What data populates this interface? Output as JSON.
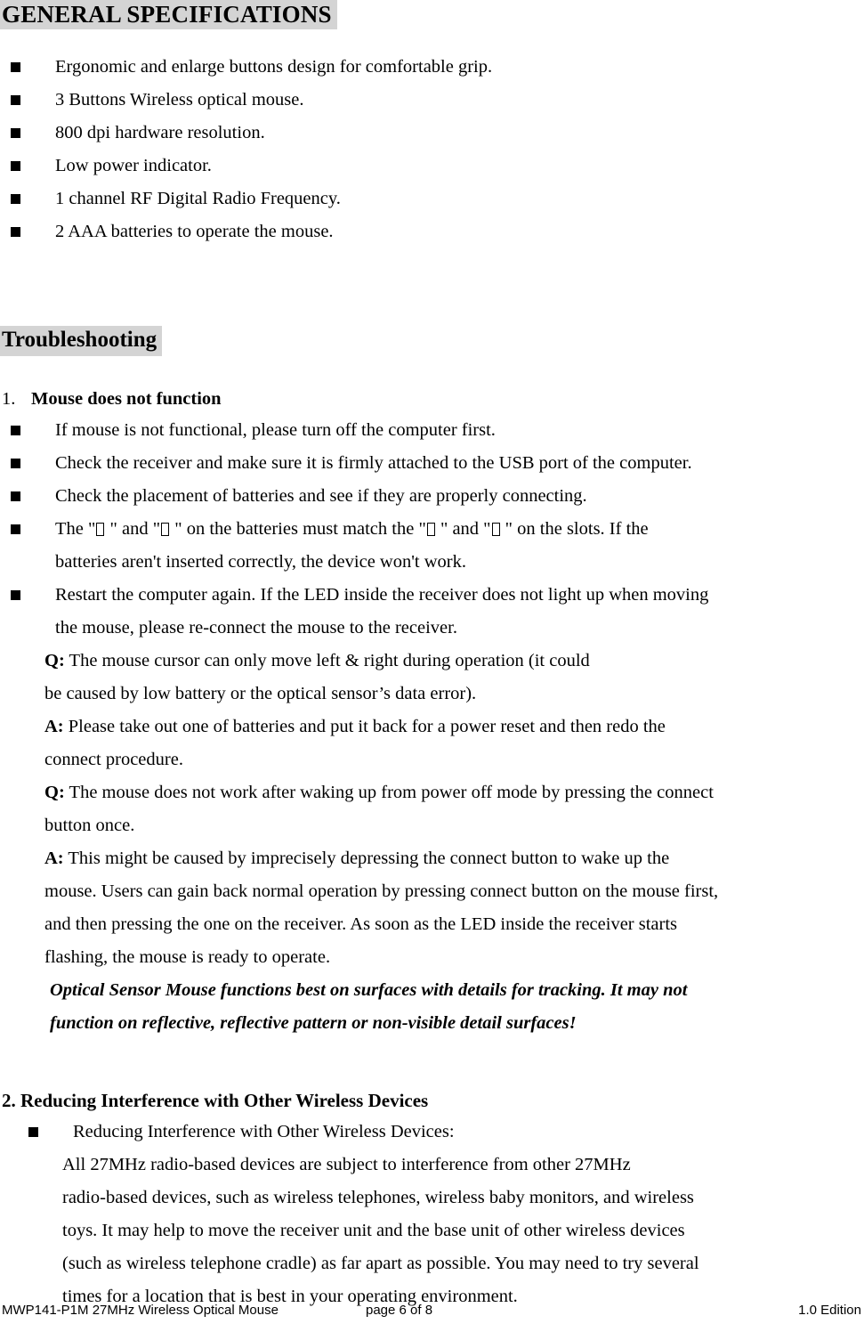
{
  "document": {
    "section_general": {
      "heading": "GENERAL SPECIFICATIONS",
      "bullets": [
        "Ergonomic and enlarge buttons design for comfortable grip.",
        "3 Buttons Wireless optical mouse.",
        "800 dpi hardware resolution.",
        "Low power indicator.",
        "1 channel RF Digital Radio Frequency.",
        "2 AAA batteries to operate the mouse."
      ]
    },
    "section_troubleshooting": {
      "heading": "Troubleshooting",
      "item1": {
        "number": "1.",
        "title": "Mouse does not function",
        "bullets": [
          "If mouse is not functional, please turn off the computer first.",
          "Check the receiver and make sure it is firmly attached to the USB port of the computer.",
          "Check the placement of batteries and see if they are properly connecting."
        ],
        "battery_bullet": {
          "part1": "The \"",
          "part2": " \" and \"",
          "part3": " \" on the batteries must match the \"",
          "part4": " \" and \"",
          "part5": " \" on the slots. If the",
          "line2": "batteries aren't inserted correctly, the device won't work."
        },
        "restart_bullet": {
          "line1": "Restart the computer again. If the LED inside the receiver does not light up when moving",
          "line2": "the mouse, please re-connect the mouse to the receiver."
        },
        "qa": [
          {
            "q_label": "Q:",
            "q_lines": [
              "The mouse cursor can only move left & right during operation (it could",
              "be caused by low battery or the optical sensor’s data error)."
            ],
            "a_label": "A:",
            "a_lines": [
              "Please take out one of batteries and put it back for a power reset and then redo the",
              "connect procedure."
            ]
          },
          {
            "q_label": "Q:",
            "q_lines": [
              "The mouse does not work after waking up from power off mode by pressing the connect",
              "button once."
            ],
            "a_label": "A:",
            "a_lines": [
              "This might be caused by imprecisely depressing the connect button to wake up the",
              "mouse. Users can gain back normal operation by pressing connect button on the mouse first,",
              "and then pressing the one on the receiver. As soon as the LED inside the receiver starts",
              "flashing, the mouse is ready to operate."
            ]
          }
        ],
        "note_lines": [
          "Optical Sensor Mouse functions best on surfaces with details for tracking.    It may not",
          "function on reflective, reflective pattern or non-visible detail surfaces!"
        ]
      },
      "item2": {
        "title": "2. Reducing Interference with Other Wireless Devices",
        "bullet": "Reducing Interference with Other Wireless Devices:",
        "body_lines": [
          "All 27MHz radio-based devices are subject to interference from other 27MHz",
          "radio-based devices, such as wireless telephones, wireless baby monitors, and wireless",
          "toys. It may help to move the receiver unit and the base unit of other wireless devices",
          "(such as wireless telephone cradle) as far apart as possible. You may need to try several",
          "times for a location that is best in your operating environment."
        ]
      }
    },
    "footer": {
      "left": "MWP141-P1M 27MHz Wireless Optical Mouse",
      "center": "page 6 of 8",
      "right": "1.0 Edition"
    },
    "colors": {
      "heading_highlight": "#d4d4d4",
      "text": "#000000",
      "background": "#ffffff"
    }
  }
}
